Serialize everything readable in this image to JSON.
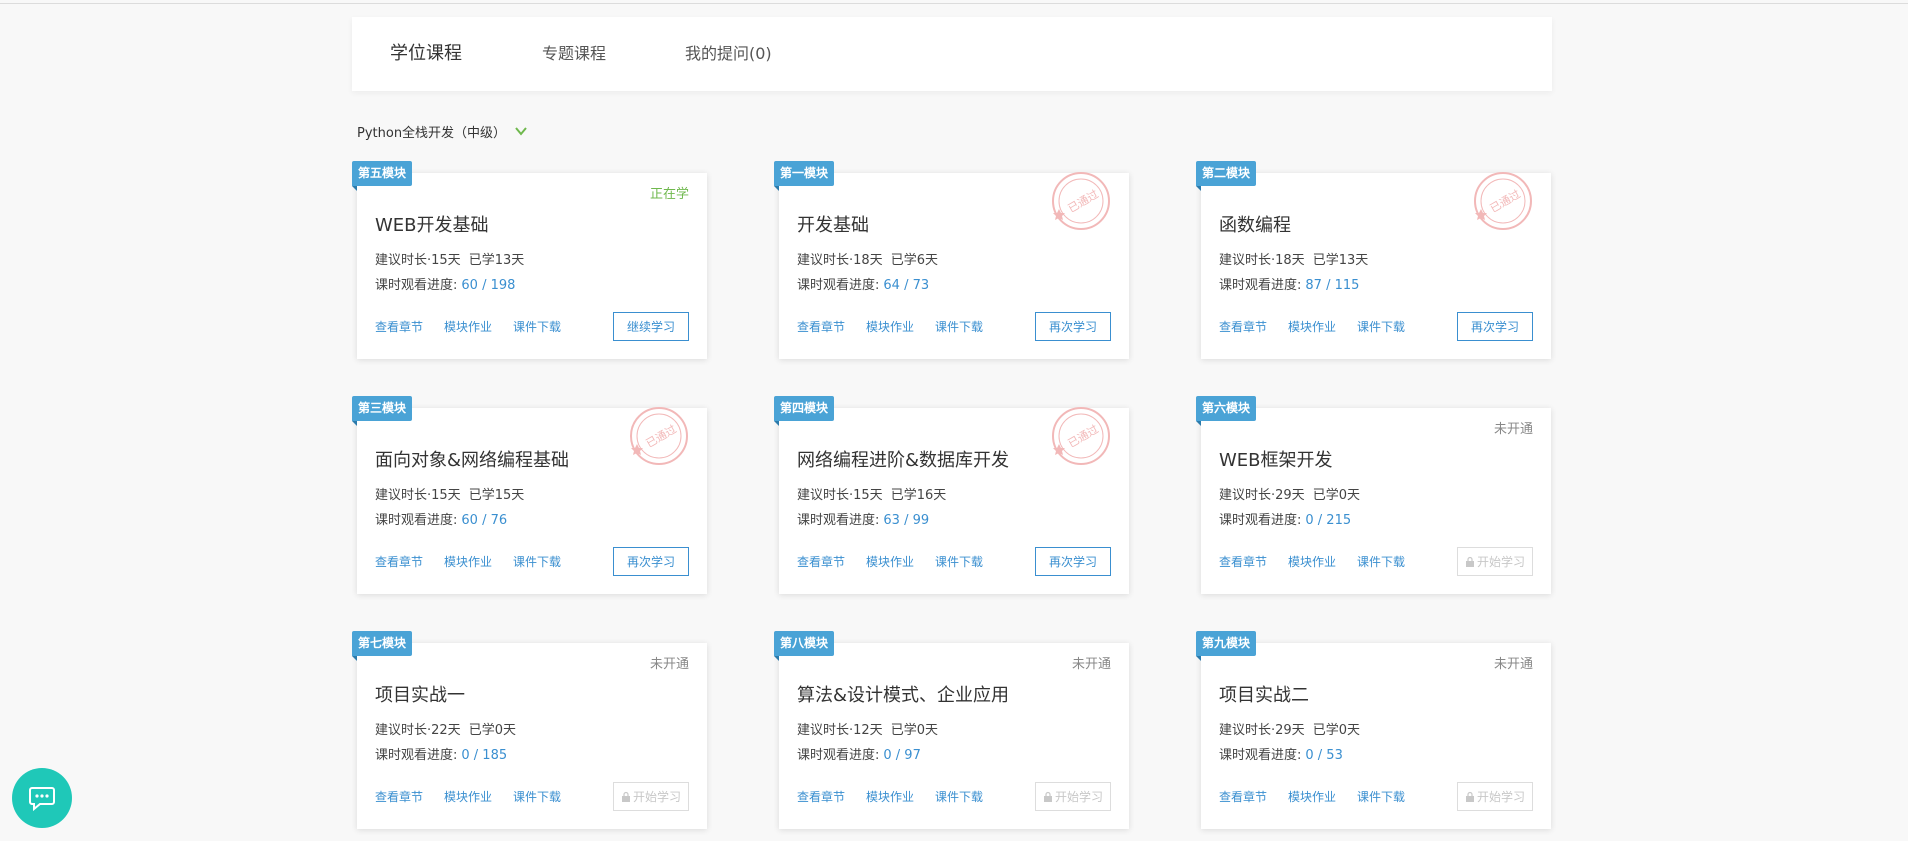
{
  "tabs": [
    {
      "label": "学位课程",
      "active": true
    },
    {
      "label": "专题课程",
      "active": false
    },
    {
      "label": "我的提问(0)",
      "active": false
    }
  ],
  "program": {
    "label": "Python全栈开发（中级）"
  },
  "stamp_text": "已通过",
  "links": {
    "chapters": "查看章节",
    "homework": "模块作业",
    "download": "课件下载"
  },
  "cards": [
    {
      "tag": "第五模块",
      "status": "正在学",
      "title": "WEB开发基础",
      "duration": "建议时长·15天",
      "learned": "已学13天",
      "progress_label": "课时观看进度:",
      "progress": "60 / 198",
      "button": "继续学习"
    },
    {
      "tag": "第一模块",
      "status": "",
      "title": "开发基础",
      "duration": "建议时长·18天",
      "learned": "已学6天",
      "progress_label": "课时观看进度:",
      "progress": "64 / 73",
      "button": "再次学习"
    },
    {
      "tag": "第二模块",
      "status": "",
      "title": "函数编程",
      "duration": "建议时长·18天",
      "learned": "已学13天",
      "progress_label": "课时观看进度:",
      "progress": "87 / 115",
      "button": "再次学习"
    },
    {
      "tag": "第三模块",
      "status": "",
      "title": "面向对象&网络编程基础",
      "duration": "建议时长·15天",
      "learned": "已学15天",
      "progress_label": "课时观看进度:",
      "progress": "60 / 76",
      "button": "再次学习"
    },
    {
      "tag": "第四模块",
      "status": "",
      "title": "网络编程进阶&数据库开发",
      "duration": "建议时长·15天",
      "learned": "已学16天",
      "progress_label": "课时观看进度:",
      "progress": "63 / 99",
      "button": "再次学习"
    },
    {
      "tag": "第六模块",
      "status": "未开通",
      "title": "WEB框架开发",
      "duration": "建议时长·29天",
      "learned": "已学0天",
      "progress_label": "课时观看进度:",
      "progress": "0 / 215",
      "button": "开始学习"
    },
    {
      "tag": "第七模块",
      "status": "未开通",
      "title": "项目实战一",
      "duration": "建议时长·22天",
      "learned": "已学0天",
      "progress_label": "课时观看进度:",
      "progress": "0 / 185",
      "button": "开始学习"
    },
    {
      "tag": "第八模块",
      "status": "未开通",
      "title": "算法&设计模式、企业应用",
      "duration": "建议时长·12天",
      "learned": "已学0天",
      "progress_label": "课时观看进度:",
      "progress": "0 / 97",
      "button": "开始学习"
    },
    {
      "tag": "第九模块",
      "status": "未开通",
      "title": "项目实战二",
      "duration": "建议时长·29天",
      "learned": "已学0天",
      "progress_label": "课时观看进度:",
      "progress": "0 / 53",
      "button": "开始学习"
    }
  ],
  "colors": {
    "accent": "#3a8fd0",
    "tag": "#4aa3d6",
    "learning": "#6fb84d",
    "stamp": "#f2b8b8",
    "chat": "#1fc8b8"
  }
}
